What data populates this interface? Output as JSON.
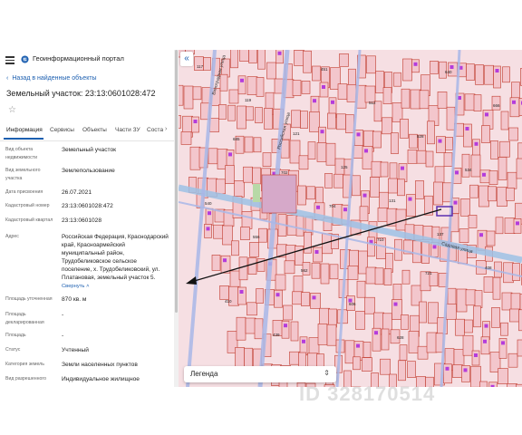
{
  "header": {
    "app_title": "Геоинформационный портал",
    "menu_icon": "hamburger-icon",
    "logo_icon": "portal-logo-icon"
  },
  "panel": {
    "back_label": "Назад в найденные объекты",
    "title": "Земельный участок: 23:13:0601028:472",
    "tabs": [
      {
        "label": "Информация"
      },
      {
        "label": "Сервисы"
      },
      {
        "label": "Объекты"
      },
      {
        "label": "Части ЗУ"
      },
      {
        "label": "Состав"
      }
    ],
    "properties": [
      {
        "label": "Вид объекта недвижимости",
        "value": "Земельный участок"
      },
      {
        "label": "Вид земельного участка",
        "value": "Землепользование"
      },
      {
        "label": "Дата присвоения",
        "value": "26.07.2021"
      },
      {
        "label": "Кадастровый номер",
        "value": "23:13:0601028:472"
      },
      {
        "label": "Кадастровый квартал",
        "value": "23:13:0601028"
      },
      {
        "label": "Адрес",
        "value": "Российская Федерация, Краснодарский край, Красноармейский муниципальный район, Трудобеликовское сельское поселение, х. Трудобеликовский, ул. Платановая, земельный участок 5."
      },
      {
        "label": "Площадь уточненная",
        "value": "870 кв. м"
      },
      {
        "label": "Площадь декларированная",
        "value": "-"
      },
      {
        "label": "Площадь",
        "value": "-"
      },
      {
        "label": "Статус",
        "value": "Учтенный"
      },
      {
        "label": "Категория земель",
        "value": "Земли населенных пунктов"
      },
      {
        "label": "Вид разрешенного",
        "value": "Индивидуальное жилищное"
      }
    ],
    "collapse_label": "Свернуть"
  },
  "map": {
    "legend_label": "Легенда",
    "street_labels": [
      "Российская улица",
      "Виноградная улица",
      "Садовая улица"
    ],
    "parcel_numbers": [
      "117",
      "119",
      "121",
      "125",
      "131",
      "137",
      "408",
      "410",
      "439",
      "451",
      "512",
      "528",
      "534",
      "540",
      "556",
      "562",
      "606",
      "628",
      "640",
      "666",
      "685",
      "702",
      "704",
      "710",
      "721"
    ]
  },
  "watermark": "ID 328170514",
  "colors": {
    "accent": "#1c5fb0",
    "parcel_fill": "#f3c6cc",
    "parcel_border": "#c0392b",
    "highlight": "#b43cdc",
    "road": "#9ec2e6",
    "arrow": "#111111"
  }
}
